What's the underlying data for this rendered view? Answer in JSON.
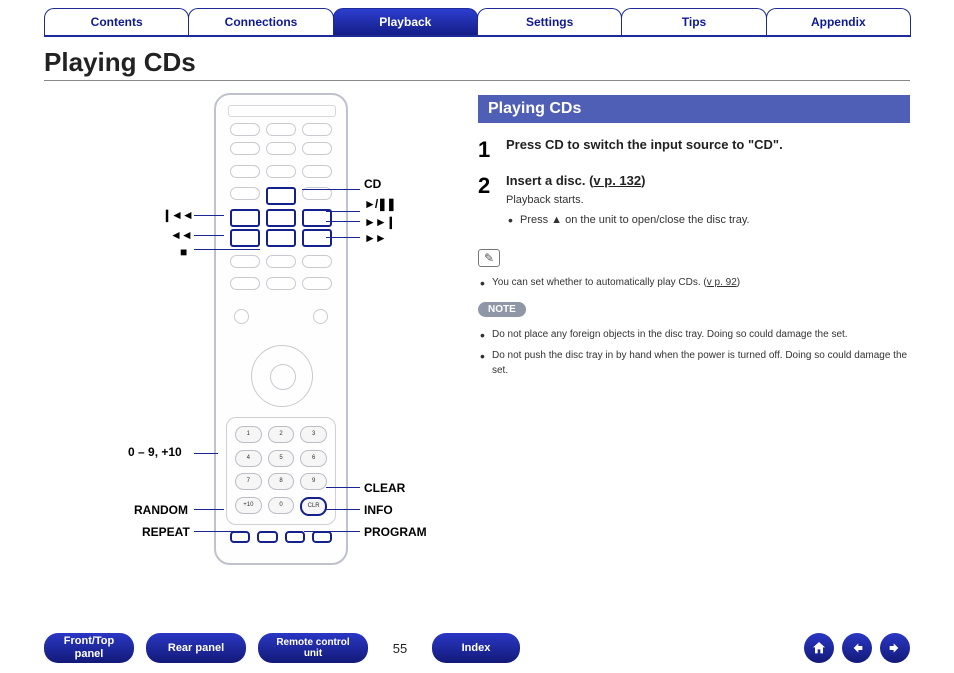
{
  "tabs": {
    "items": [
      "Contents",
      "Connections",
      "Playback",
      "Settings",
      "Tips",
      "Appendix"
    ],
    "active_index": 2
  },
  "page_title": "Playing CDs",
  "remote_labels": {
    "cd": "CD",
    "play_pause": "►/❚❚",
    "prev": "❙◄◄",
    "next": "►►❙",
    "rew": "◄◄",
    "ffwd": "►►",
    "stop": "■",
    "numpad": "0 – 9, +10",
    "random": "RANDOM",
    "repeat": "REPEAT",
    "clear": "CLEAR",
    "info": "INFO",
    "program": "PROGRAM"
  },
  "content": {
    "subheading": "Playing CDs",
    "step1": {
      "num": "1",
      "text": "Press CD to switch the input source to \"CD\"."
    },
    "step2": {
      "num": "2",
      "text": "Insert a disc.  (",
      "link": "v p. 132",
      "text_end": ")",
      "sub1": "Playback starts.",
      "bullet": "Press ▲ on the unit to open/close the disc tray."
    },
    "auto_note": "You can set whether to automatically play CDs.  (",
    "auto_link": "v p. 92",
    "auto_end": ")",
    "note_label": "NOTE",
    "note_items": [
      "Do not place any foreign objects in the disc tray. Doing so could damage the set.",
      "Do not push the disc tray in by hand when the power is turned off. Doing so could damage the set."
    ]
  },
  "footer": {
    "buttons": [
      "Front/Top\npanel",
      "Rear panel",
      "Remote control\nunit",
      "Index"
    ],
    "page": "55",
    "nav": [
      "home",
      "prev",
      "next"
    ]
  }
}
